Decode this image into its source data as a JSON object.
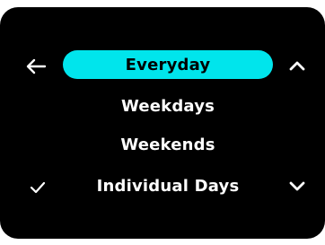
{
  "menu": {
    "items": [
      {
        "label": "Everyday",
        "selected": true,
        "checked": false
      },
      {
        "label": "Weekdays",
        "selected": false,
        "checked": false
      },
      {
        "label": "Weekends",
        "selected": false,
        "checked": false
      },
      {
        "label": "Individual Days",
        "selected": false,
        "checked": true
      }
    ]
  },
  "icons": {
    "back": "left-arrow-icon",
    "scroll_up": "chevron-up-icon",
    "scroll_down": "chevron-down-icon",
    "check": "checkmark-icon"
  },
  "colors": {
    "background": "#000000",
    "highlight": "#00e5ec",
    "text": "#ffffff",
    "selected_text": "#000000"
  }
}
